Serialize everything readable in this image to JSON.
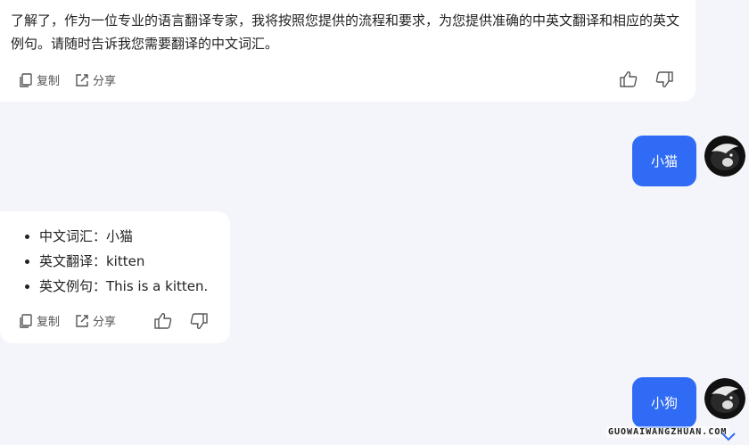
{
  "conversation": {
    "ai_message_1": {
      "text": "了解了，作为一位专业的语言翻译专家，我将按照您提供的流程和要求，为您提供准确的中英文翻译和相应的英文例句。请随时告诉我您需要翻译的中文词汇。",
      "copy_label": "复制",
      "share_label": "分享"
    },
    "user_message_1": {
      "text": "小猫"
    },
    "ai_message_2": {
      "items": [
        "中文词汇：小猫",
        "英文翻译：kitten",
        "英文例句：This is a kitten."
      ],
      "copy_label": "复制",
      "share_label": "分享"
    },
    "user_message_2": {
      "text": "小狗"
    }
  },
  "watermark": "GUOWAIWANGZHUAN.COM",
  "colors": {
    "background": "#f4f5fa",
    "user_bubble": "#2f6bf4",
    "ai_bubble": "#ffffff",
    "scroll_button": "#2f6bf4"
  },
  "icons": {
    "copy": "copy-icon",
    "share": "share-icon",
    "like": "thumbs-up-icon",
    "dislike": "thumbs-down-icon",
    "scroll": "chevron-down-icon"
  }
}
